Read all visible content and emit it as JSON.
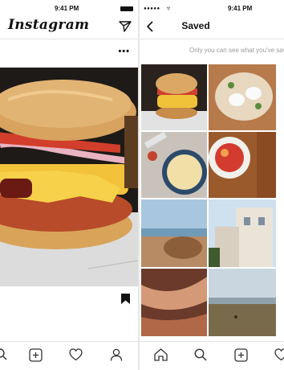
{
  "left_screen": {
    "status_time": "9:41 PM",
    "app_title": "Instagram",
    "more_label": "•••"
  },
  "right_screen": {
    "status_time": "9:41 PM",
    "title": "Saved",
    "notice": "Only you can see what you've saved"
  },
  "icons": {
    "left_header": [
      "direct-send-icon"
    ],
    "left_post": [
      "more-options-icon",
      "bookmark-icon"
    ],
    "left_nav": [
      "search-icon",
      "add-post-icon",
      "heart-icon",
      "profile-icon"
    ],
    "right_header": [
      "back-arrow-icon"
    ],
    "right_nav": [
      "home-icon",
      "search-icon",
      "add-post-icon",
      "heart-icon"
    ]
  },
  "saved_grid_items": [
    "burger",
    "eggs",
    "cereal bowl",
    "salad",
    "beach rocks",
    "houses",
    "canyon",
    "lake landscape"
  ]
}
